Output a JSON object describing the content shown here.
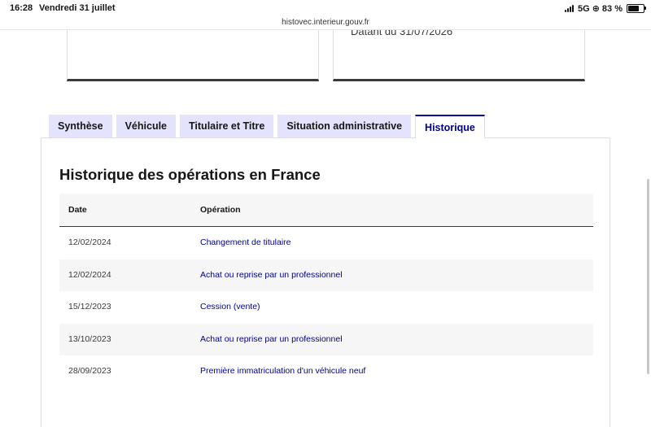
{
  "status_bar": {
    "time": "16:28",
    "date": "Vendredi 31 juillet",
    "network": "5G",
    "battery": "83 %",
    "battery_level": 0.83
  },
  "browser": {
    "url": "histovec.interieur.gouv.fr"
  },
  "cards": {
    "right_card_text": "Datant du 31/07/2026"
  },
  "tabs": [
    {
      "label": "Synthèse",
      "active": false
    },
    {
      "label": "Véhicule",
      "active": false
    },
    {
      "label": "Titulaire et Titre",
      "active": false
    },
    {
      "label": "Situation administrative",
      "active": false
    },
    {
      "label": "Historique",
      "active": true
    }
  ],
  "history": {
    "title": "Historique des opérations en France",
    "columns": [
      "Date",
      "Opération"
    ],
    "rows": [
      {
        "date": "12/02/2024",
        "operation": "Changement de titulaire"
      },
      {
        "date": "12/02/2024",
        "operation": "Achat ou reprise par un professionnel"
      },
      {
        "date": "15/12/2023",
        "operation": "Cession (vente)"
      },
      {
        "date": "13/10/2023",
        "operation": "Achat ou reprise par un professionnel"
      },
      {
        "date": "28/09/2023",
        "operation": "Première immatriculation d'un véhicule neuf"
      }
    ]
  },
  "colors": {
    "primary": "#000091",
    "tab_inactive_bg": "#e3e3fd",
    "row_alt_bg": "#f6f6f6",
    "text": "#161616"
  }
}
